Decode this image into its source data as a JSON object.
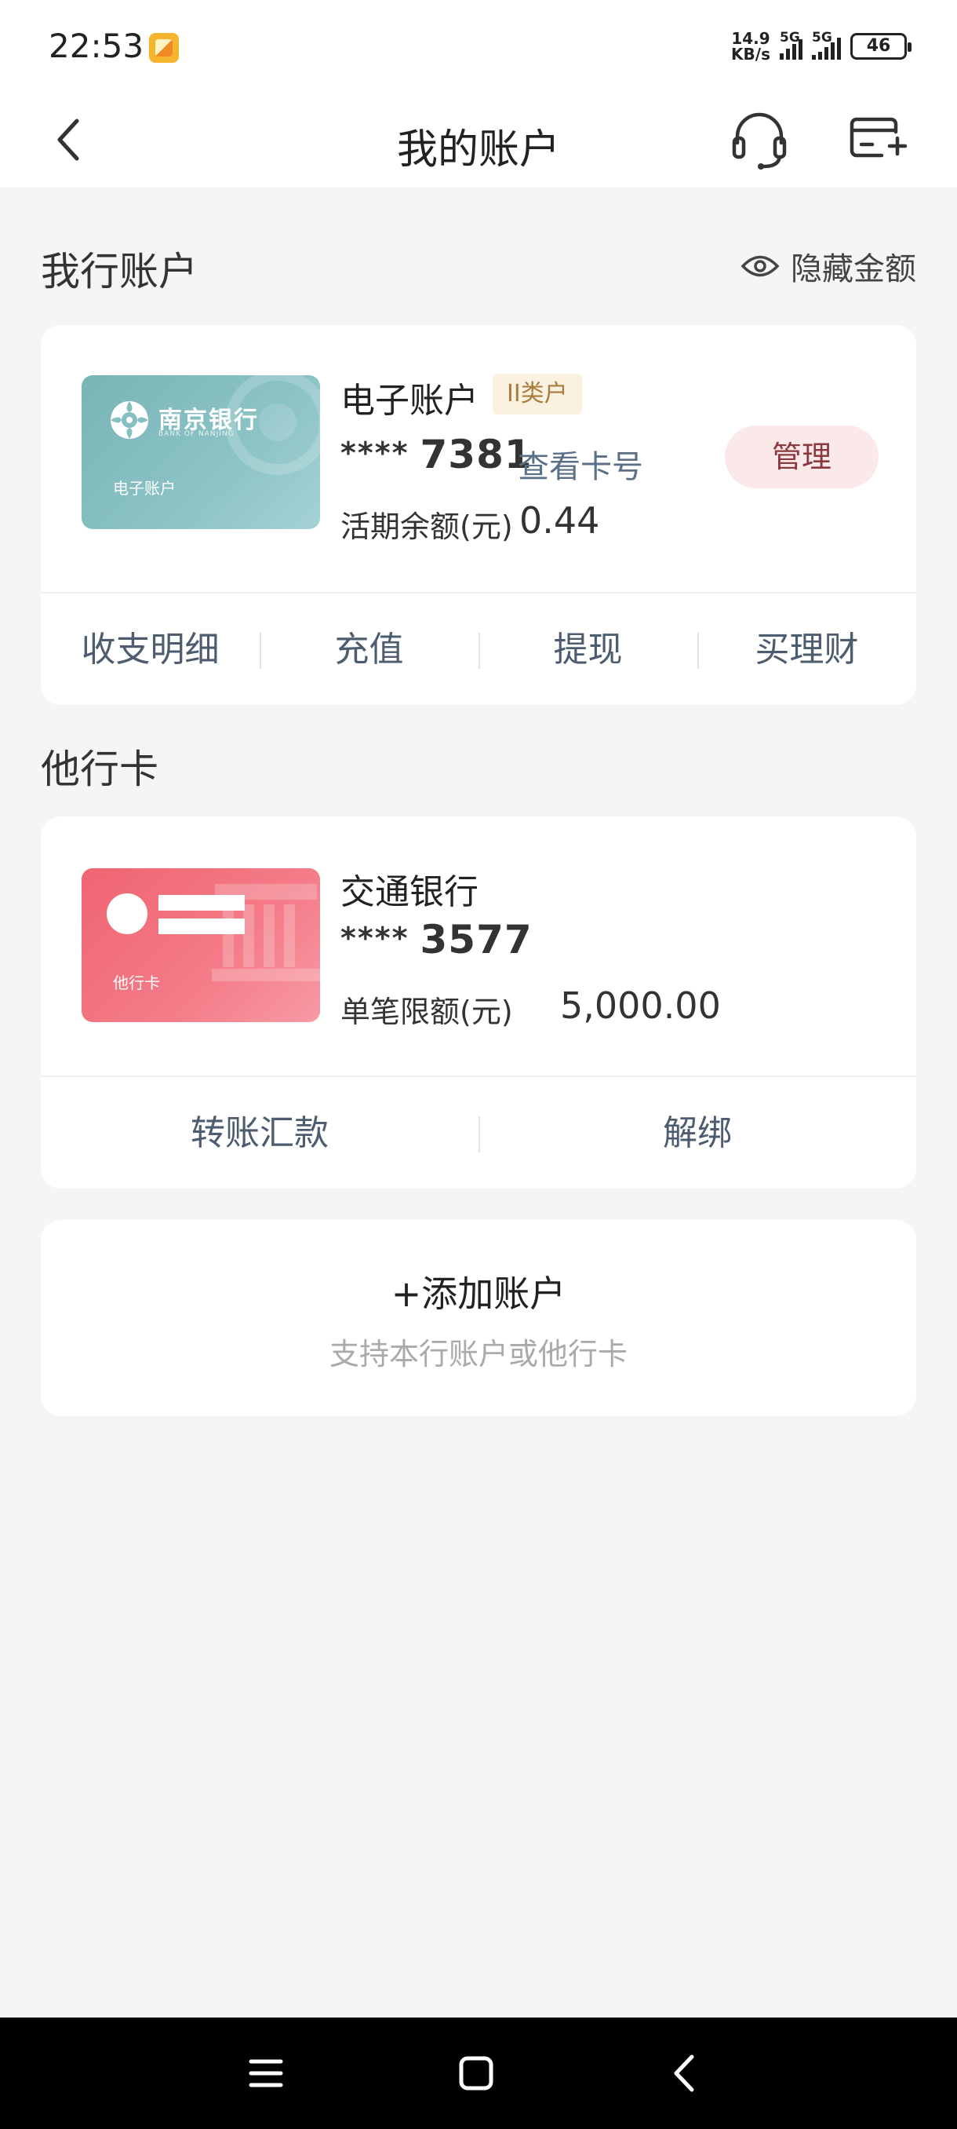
{
  "status_bar": {
    "time": "22:53",
    "net_speed_value": "14.9",
    "net_speed_unit": "KB/s",
    "signal1_label": "5G",
    "signal2_label": "5G",
    "battery": "46"
  },
  "header": {
    "title": "我的账户",
    "back_icon": "chevron-left-icon",
    "service_icon": "headset-icon",
    "add_card_icon": "card-add-icon"
  },
  "own_accounts": {
    "section_title": "我行账户",
    "hide_amount_label": "隐藏金额",
    "card": {
      "bank_logo_text": "南京银行",
      "bank_logo_sub": "BANK OF NANJING",
      "image_caption": "电子账户",
      "name": "电子账户",
      "badge": "II类户",
      "number_mask": "****",
      "number_last4": "7381",
      "view_number_label": "查看卡号",
      "manage_label": "管理",
      "balance_label": "活期余额(元)",
      "balance_value": "0.44"
    },
    "actions": [
      "收支明细",
      "充值",
      "提现",
      "买理财"
    ]
  },
  "other_cards": {
    "section_title": "他行卡",
    "card": {
      "image_caption": "他行卡",
      "bank_name": "交通银行",
      "number_mask": "****",
      "number_last4": "3577",
      "limit_label": "单笔限额(元)",
      "limit_value": "5,000.00"
    },
    "actions": [
      "转账汇款",
      "解绑"
    ]
  },
  "add_account": {
    "title": "+添加账户",
    "subtitle": "支持本行账户或他行卡"
  },
  "colors": {
    "background": "#f5f5f5",
    "teal_card": "#86bfc1",
    "red_card": "#f06c79",
    "manage_bg": "#fbe9ea",
    "badge_bg": "#fbf1e1"
  }
}
